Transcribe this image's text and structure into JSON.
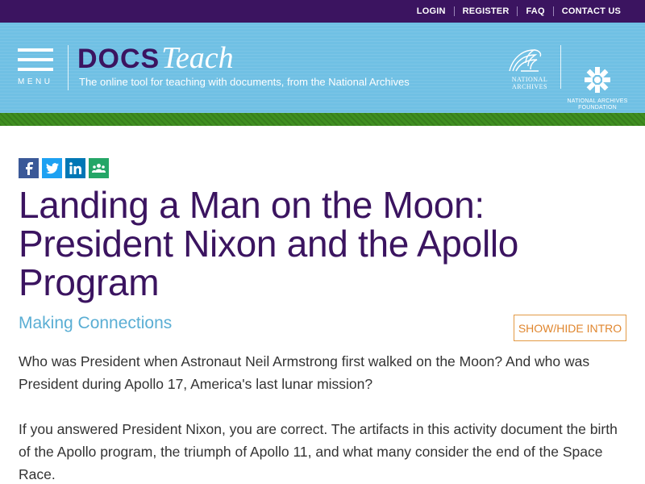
{
  "topbar": {
    "links": [
      "LOGIN",
      "REGISTER",
      "FAQ",
      "CONTACT US"
    ]
  },
  "header": {
    "menu_label": "MENU",
    "logo_docs": "DOCS",
    "logo_teach": "Teach",
    "tagline": "The online tool for teaching with documents, from the National Archives",
    "nara_text": "NATIONAL ARCHIVES",
    "foundation_text": "NATIONAL ARCHIVES FOUNDATION"
  },
  "share": [
    {
      "name": "facebook-icon",
      "glyph": "f",
      "color": "#3b5998"
    },
    {
      "name": "twitter-icon",
      "glyph": "t",
      "color": "#1da1f2"
    },
    {
      "name": "linkedin-icon",
      "glyph": "in",
      "color": "#0077b5"
    },
    {
      "name": "google-classroom-icon",
      "glyph": "gc",
      "color": "#25a667"
    }
  ],
  "page": {
    "title": "Landing a Man on the Moon: President Nixon and the Apollo Program",
    "subtitle": "Making Connections",
    "toggle_label": "SHOW/HIDE INTRO",
    "paragraphs": [
      "Who was President when Astronaut Neil Armstrong first walked on the Moon? And who was President during Apollo 17, America's last lunar mission?",
      "If you answered President Nixon, you are correct. The artifacts in this activity document the birth of the Apollo program, the triumph of Apollo 11, and what many consider the end of the Space Race."
    ]
  },
  "colors": {
    "topbar": "#3b1460",
    "header": "#70c0e4",
    "strip": "#3f8f20",
    "title": "#3b1460",
    "subtitle": "#5aaed4",
    "accent": "#e0862e"
  }
}
